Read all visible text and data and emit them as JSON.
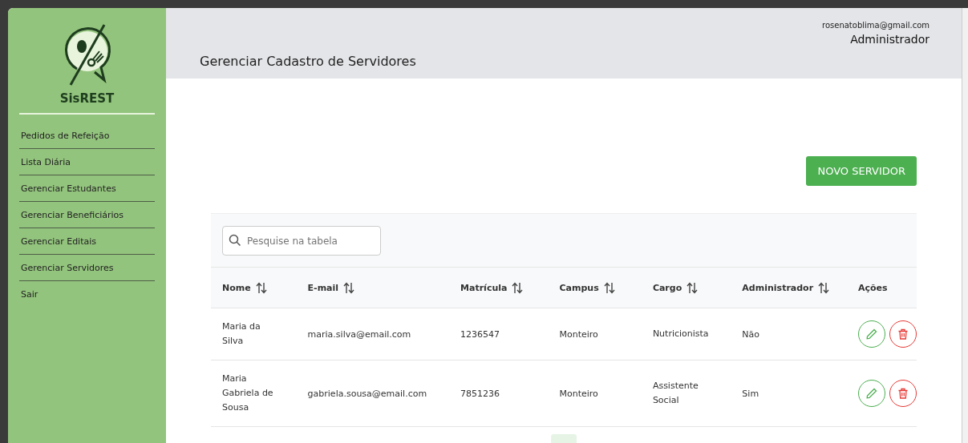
{
  "sidebar": {
    "app_name": "SisREST",
    "items": [
      {
        "label": "Pedidos de Refeição",
        "selected": false
      },
      {
        "label": "Lista Diária",
        "selected": false
      },
      {
        "label": "Gerenciar Estudantes",
        "selected": false
      },
      {
        "label": "Gerenciar Beneficiários",
        "selected": false
      },
      {
        "label": "Gerenciar Editais",
        "selected": false
      },
      {
        "label": "Gerenciar Servidores",
        "selected": false
      },
      {
        "label": "Sair",
        "selected": false
      }
    ]
  },
  "header": {
    "title": "Gerenciar Cadastro de Servidores",
    "user_email": "rosenatoblima@gmail.com",
    "user_role": "Administrador"
  },
  "new_button": "NOVO SERVIDOR",
  "search": {
    "placeholder": "Pesquise na tabela"
  },
  "table": {
    "columns": [
      {
        "label": "Nome",
        "sortable": true
      },
      {
        "label": "E-mail",
        "sortable": true
      },
      {
        "label": "Matrícula",
        "sortable": true
      },
      {
        "label": "Campus",
        "sortable": true
      },
      {
        "label": "Cargo",
        "sortable": true
      },
      {
        "label": "Administrador",
        "sortable": true
      },
      {
        "label": "Ações",
        "sortable": false
      }
    ],
    "rows": [
      {
        "cells": [
          "Maria da Silva",
          "maria.silva@email.com",
          "1236547",
          "Monteiro",
          "Nutricionista",
          "Não"
        ]
      },
      {
        "cells": [
          "Maria Gabriela de Sousa",
          "gabriela.sousa@email.com",
          "7851236",
          "Monteiro",
          "Assistente Social",
          "Sim"
        ]
      }
    ]
  }
}
